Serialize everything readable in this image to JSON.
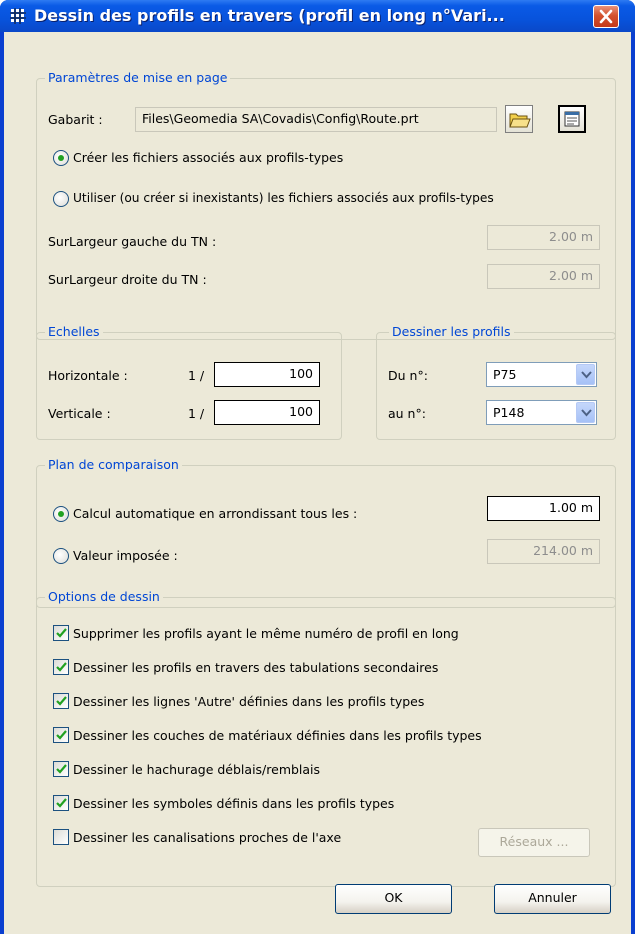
{
  "window": {
    "title": "Dessin des profils en travers (profil en long n°Vari...",
    "title_icon": "grid-app-icon",
    "close_icon": "close-icon"
  },
  "mise_en_page": {
    "label": "Paramètres de mise en page",
    "gabarit_label": "Gabarit :",
    "gabarit_value": "Files\\Geomedia SA\\Covadis\\Config\\Route.prt",
    "browse_icon": "open-folder-icon",
    "edit_icon": "properties-icon",
    "radio_creer": "Créer les fichiers associés aux profils-types",
    "radio_utiliser": "Utiliser (ou créer si inexistants) les fichiers associés aux profils-types",
    "selected_radio": "creer",
    "surlargeur_gauche_label": "SurLargeur gauche du TN :",
    "surlargeur_gauche_value": "2.00 m",
    "surlargeur_droite_label": "SurLargeur droite du TN :",
    "surlargeur_droite_value": "2.00 m"
  },
  "echelles": {
    "label": "Echelles",
    "horizontale_label": "Horizontale :",
    "horizontale_prefix": "1 /",
    "horizontale_value": "100",
    "verticale_label": "Verticale :",
    "verticale_prefix": "1 /",
    "verticale_value": "100"
  },
  "dessiner_profils": {
    "label": "Dessiner les profils",
    "du_label": "Du n°:",
    "du_value": "P75",
    "au_label": "au n°:",
    "au_value": "P148"
  },
  "plan_comparaison": {
    "label": "Plan de comparaison",
    "radio_auto": "Calcul automatique en arrondissant tous les :",
    "auto_value": "1.00 m",
    "radio_imposee": "Valeur imposée :",
    "imposee_value": "214.00 m",
    "selected_radio": "auto"
  },
  "options": {
    "label": "Options de dessin",
    "items": [
      {
        "label": "Supprimer les profils ayant le même numéro de profil en long",
        "checked": true
      },
      {
        "label": "Dessiner les profils en travers des tabulations secondaires",
        "checked": true
      },
      {
        "label": "Dessiner les lignes 'Autre' définies dans les profils types",
        "checked": true
      },
      {
        "label": "Dessiner les couches de matériaux définies dans les profils types",
        "checked": true
      },
      {
        "label": "Dessiner le hachurage déblais/remblais",
        "checked": true
      },
      {
        "label": "Dessiner les symboles définis dans les profils types",
        "checked": true
      },
      {
        "label": "Dessiner les canalisations proches de l'axe",
        "checked": false
      }
    ],
    "reseaux_button": "Réseaux ..."
  },
  "buttons": {
    "ok": "OK",
    "cancel": "Annuler"
  },
  "colors": {
    "titlebar": "#0853dc",
    "dialog_bg": "#ece9d8",
    "group_label": "#0046d5",
    "check_mark": "#21a121"
  }
}
